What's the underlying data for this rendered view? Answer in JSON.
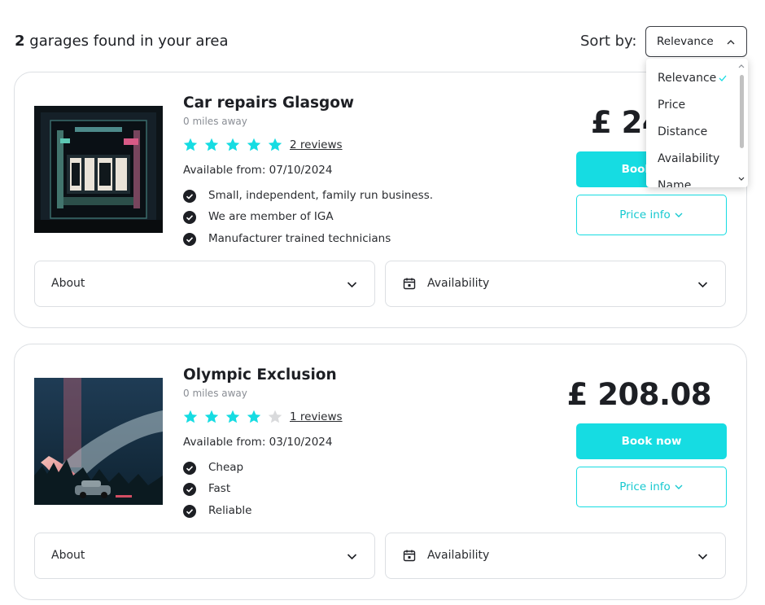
{
  "header": {
    "results_count": "2",
    "results_text": "garages found in your area",
    "sort_label": "Sort by:",
    "sort_value": "Relevance"
  },
  "sort_dropdown": {
    "options": [
      "Relevance",
      "Price",
      "Distance",
      "Availability",
      "Name"
    ],
    "selected": "Relevance"
  },
  "colors": {
    "accent": "#16dce2",
    "star_filled": "#16dce2",
    "star_empty": "#d9dadc",
    "text": "#1d1f24"
  },
  "garages": [
    {
      "name": "Car repairs Glasgow",
      "distance": "0 miles away",
      "rating": 5,
      "reviews": "2 reviews",
      "available": "Available from: 07/10/2024",
      "features": [
        "Small, independent, family run business.",
        "We are member of IGA",
        "Manufacturer trained technicians"
      ],
      "price": "£ 24",
      "book_label": "Book now",
      "priceinfo_label": "Price info",
      "about_label": "About",
      "availability_label": "Availability"
    },
    {
      "name": "Olympic Exclusion",
      "distance": "0 miles away",
      "rating": 4,
      "reviews": "1 reviews",
      "available": "Available from: 03/10/2024",
      "features": [
        "Cheap",
        "Fast",
        "Reliable"
      ],
      "price": "£ 208.08",
      "book_label": "Book now",
      "priceinfo_label": "Price info",
      "about_label": "About",
      "availability_label": "Availability"
    }
  ]
}
